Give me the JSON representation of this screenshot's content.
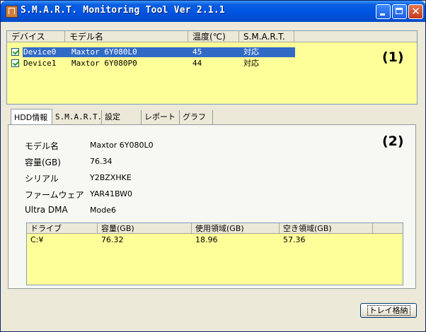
{
  "window": {
    "title": "S.M.A.R.T. Monitoring Tool  Ver 2.1.1",
    "close_glyph": "✕"
  },
  "device_list": {
    "columns": [
      "デバイス",
      "モデル名",
      "温度(℃)",
      "S.M.A.R.T."
    ],
    "rows": [
      {
        "device": "Device0",
        "model": "Maxtor 6Y080L0",
        "temp": "45",
        "smart": "対応",
        "checked": true,
        "selected": true
      },
      {
        "device": "Device1",
        "model": "Maxtor 6Y080P0",
        "temp": "44",
        "smart": "対応",
        "checked": true,
        "selected": false
      }
    ],
    "annotation": "(1)"
  },
  "tabs": [
    "HDD情報",
    "S.M.A.R.T.",
    "設定",
    "レポート",
    "グラフ"
  ],
  "hdd_info": {
    "annotation": "(2)",
    "fields": [
      {
        "label": "モデル名",
        "value": "Maxtor 6Y080L0"
      },
      {
        "label": "容量(GB)",
        "value": "76.34"
      },
      {
        "label": "シリアル",
        "value": "Y2BZXHKE"
      },
      {
        "label": "ファームウェア",
        "value": "YAR41BW0"
      },
      {
        "label": "Ultra DMA",
        "value": "Mode6"
      }
    ]
  },
  "drive_table": {
    "columns": [
      "ドライブ",
      "容量(GB)",
      "使用領域(GB)",
      "空き領域(GB)"
    ],
    "rows": [
      {
        "drive": "C:¥",
        "capacity": "76.32",
        "used": "18.96",
        "free": "57.36"
      }
    ]
  },
  "tray_button": "トレイ格納",
  "colors": {
    "list_background": "#ffff99",
    "selection": "#316ac5",
    "titlebar": "#0054e3",
    "window_face": "#ece9d8"
  }
}
